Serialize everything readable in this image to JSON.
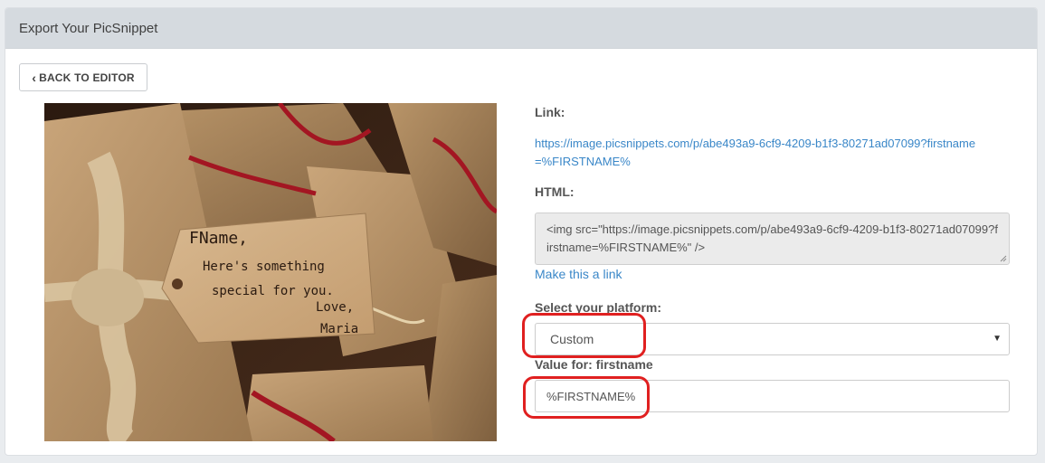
{
  "header": {
    "title": "Export Your PicSnippet"
  },
  "toolbar": {
    "back_label": "BACK TO EDITOR"
  },
  "image": {
    "tag_lines": [
      "FName,",
      "Here's something",
      "special for you.",
      "Love,",
      "Maria"
    ]
  },
  "link": {
    "label": "Link:",
    "url": "https://image.picsnippets.com/p/abe493a9-6cf9-4209-b1f3-80271ad07099?firstname=%FIRSTNAME%"
  },
  "html": {
    "label": "HTML:",
    "code": "<img src=\"https://image.picsnippets.com/p/abe493a9-6cf9-4209-b1f3-80271ad07099?firstname=%FIRSTNAME%\" />",
    "make_link": "Make this a link"
  },
  "platform": {
    "label": "Select your platform:",
    "selected": "Custom"
  },
  "value": {
    "label": "Value for: firstname",
    "value": "%FIRSTNAME%"
  },
  "colors": {
    "link": "#3a87c8",
    "highlight": "#e02020",
    "header_bg": "#d5dadf"
  }
}
